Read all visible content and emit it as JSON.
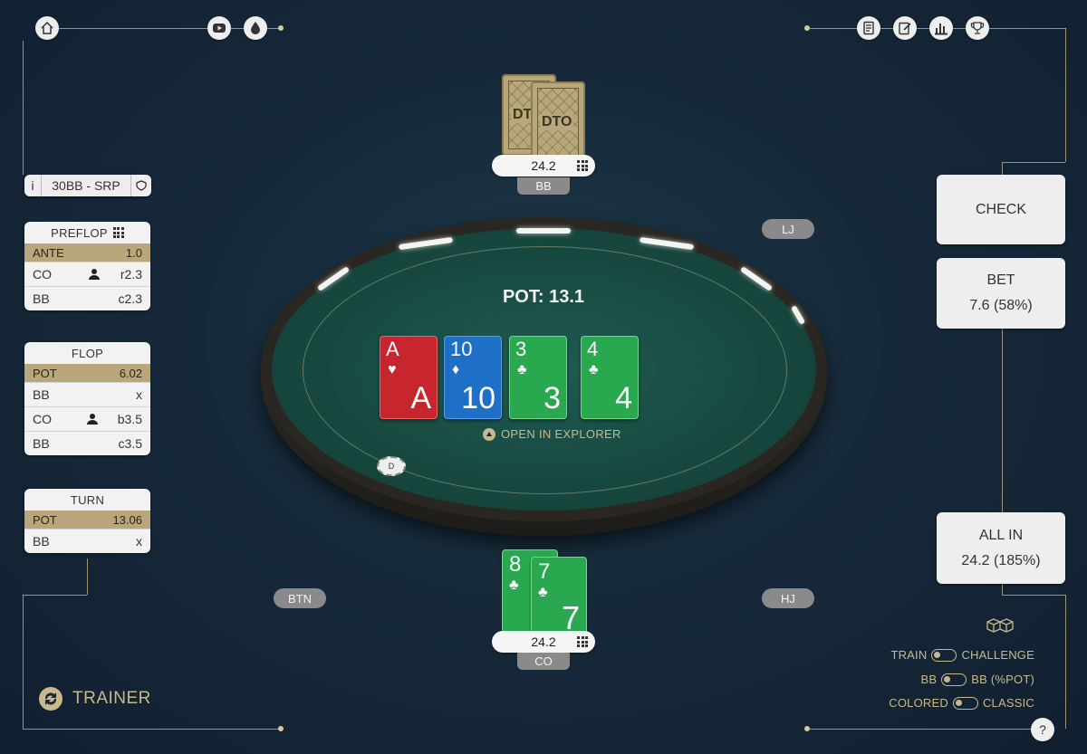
{
  "nav": {
    "home_icon": "home-icon",
    "video_icon": "youtube-icon",
    "drop_icon": "drop-icon",
    "right_icons": [
      "notes-icon",
      "edit-icon",
      "chart-icon",
      "trophy-icon"
    ]
  },
  "spot": {
    "info": "i",
    "label": "30BB - SRP"
  },
  "history": {
    "preflop": {
      "title": "PREFLOP",
      "ante_label": "ANTE",
      "ante_value": "1.0",
      "rows": [
        {
          "pos": "CO",
          "action": "r2.3"
        },
        {
          "pos": "BB",
          "action": "c2.3"
        }
      ]
    },
    "flop": {
      "title": "FLOP",
      "pot_label": "POT",
      "pot_value": "6.02",
      "rows": [
        {
          "pos": "BB",
          "action": "x"
        },
        {
          "pos": "CO",
          "action": "b3.5"
        },
        {
          "pos": "BB",
          "action": "c3.5"
        }
      ]
    },
    "turn": {
      "title": "TURN",
      "pot_label": "POT",
      "pot_value": "13.06",
      "rows": [
        {
          "pos": "BB",
          "action": "x"
        }
      ]
    }
  },
  "table": {
    "pot_text": "POT: 13.1",
    "board": [
      {
        "rank": "A",
        "suit": "♥",
        "color": "#c8262e"
      },
      {
        "rank": "10",
        "suit": "♦",
        "color": "#1e6fc6"
      },
      {
        "rank": "3",
        "suit": "♣",
        "color": "#2aa84f"
      },
      {
        "rank": "4",
        "suit": "♣",
        "color": "#2aa84f"
      }
    ],
    "explorer_label": "OPEN IN EXPLORER",
    "dealer_button": "D"
  },
  "seats": {
    "top": {
      "label": "BB",
      "stack": "24.2",
      "card_back_text": "DTO"
    },
    "bottom": {
      "label": "CO",
      "stack": "24.2",
      "cards": [
        {
          "rank": "8",
          "suit": "♣"
        },
        {
          "rank": "7",
          "suit": "♣"
        }
      ]
    },
    "lj": "LJ",
    "btn": "BTN",
    "hj": "HJ"
  },
  "actions": {
    "check": "CHECK",
    "bet_label": "BET",
    "bet_value": "7.6 (58%)",
    "allin_label": "ALL IN",
    "allin_value": "24.2 (185%)"
  },
  "toggles": [
    {
      "left": "TRAIN",
      "right": "CHALLENGE"
    },
    {
      "left": "BB",
      "right": "BB (%POT)"
    },
    {
      "left": "COLORED",
      "right": "CLASSIC"
    }
  ],
  "brand": {
    "name": "TRAINER"
  },
  "help": "?",
  "colors": {
    "gold": "#c8b98c",
    "felt": "#17483f",
    "background": "#16293a"
  }
}
